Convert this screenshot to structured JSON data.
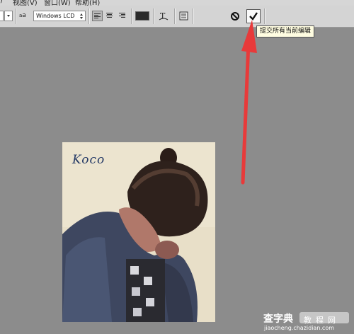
{
  "menu": [
    ")",
    "视图(V)",
    "窗口(W)",
    "帮助(H)"
  ],
  "options_bar": {
    "antialias_icon_label": "a",
    "antialias_icon_label2": "a",
    "antialias_value": "Windows LCD",
    "text_color": "#2a2a2a",
    "icons": [
      "font-size-dropdown-icon",
      "antialias-icon",
      "align-left-icon",
      "align-center-icon",
      "align-right-icon",
      "warp-text-icon",
      "character-panel-icon",
      "cancel-icon",
      "commit-check-icon"
    ]
  },
  "tooltip": "提交所有当前编辑",
  "signature": "Koco",
  "watermark": {
    "brand": "查字典",
    "box": "教程网",
    "url": "jiaocheng.chazidian.com"
  },
  "colors": {
    "toolbar": "#d4d4d4",
    "workspace": "#8c8c8c",
    "arrow": "#e83a3a",
    "tooltip_bg": "#fffde1"
  }
}
